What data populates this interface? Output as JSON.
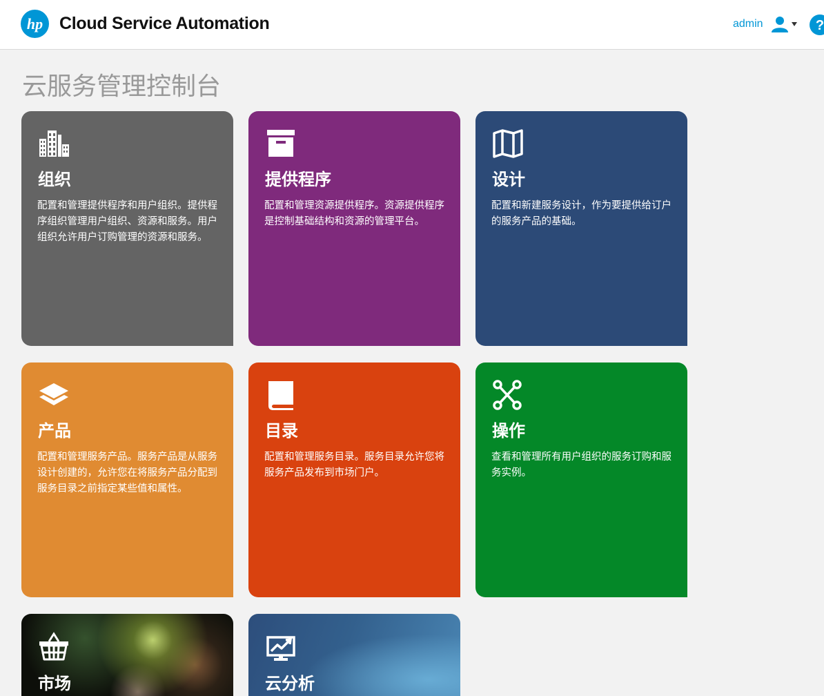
{
  "header": {
    "logo_text": "hp",
    "app_title": "Cloud Service Automation",
    "user_name": "admin",
    "user_icon": "user-icon",
    "menu_caret_icon": "caret-down-icon",
    "help_label": "?",
    "help_icon": "help-icon"
  },
  "page": {
    "title": "云服务管理控制台"
  },
  "tiles": [
    {
      "title": "组织",
      "description": "配置和管理提供程序和用户组织。提供程序组织管理用户组织、资源和服务。用户组织允许用户订购管理的资源和服务。",
      "icon": "buildings-icon",
      "color": "#646464"
    },
    {
      "title": "提供程序",
      "description": "配置和管理资源提供程序。资源提供程序是控制基础结构和资源的管理平台。",
      "icon": "archive-box-icon",
      "color": "#7f2a7c"
    },
    {
      "title": "设计",
      "description": "配置和新建服务设计，作为要提供给订户的服务产品的基础。",
      "icon": "map-icon",
      "color": "#2c4a77"
    },
    {
      "title": "产品",
      "description": "配置和管理服务产品。服务产品是从服务设计创建的，允许您在将服务产品分配到服务目录之前指定某些值和属性。",
      "icon": "layers-icon",
      "color": "#e08b32"
    },
    {
      "title": "目录",
      "description": "配置和管理服务目录。服务目录允许您将服务产品发布到市场门户。",
      "icon": "book-icon",
      "color": "#d9420f"
    },
    {
      "title": "操作",
      "description": "查看和管理所有用户组织的服务订购和服务实例。",
      "icon": "network-nodes-icon",
      "color": "#048828"
    },
    {
      "title": "市场",
      "description": "",
      "icon": "shopping-basket-icon",
      "color": "#0d0f0a"
    },
    {
      "title": "云分析",
      "description": "",
      "icon": "analytics-chart-icon",
      "color": "#33608d"
    }
  ]
}
